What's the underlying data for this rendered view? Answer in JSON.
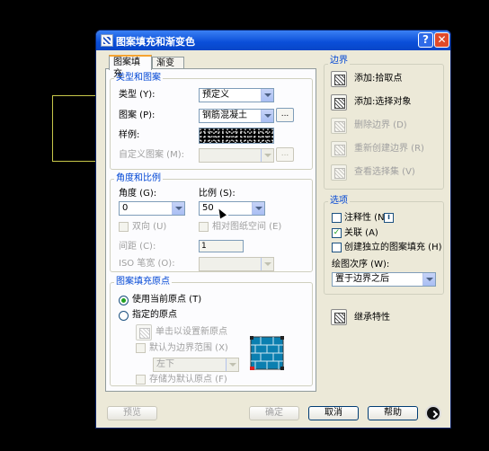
{
  "dialog": {
    "title": "图案填充和渐变色",
    "help_button": "?",
    "close_button": "✕"
  },
  "tabs": [
    {
      "label": "图案填充",
      "active": true
    },
    {
      "label": "渐变色",
      "active": false
    }
  ],
  "type_pattern": {
    "title": "类型和图案",
    "type_label": "类型 (Y):",
    "type_value": "预定义",
    "pattern_label": "图案 (P):",
    "pattern_value": "钢筋混凝土",
    "ellipsis": "...",
    "swatch_label": "样例:",
    "custom_label": "自定义图案 (M):",
    "custom_value": ""
  },
  "angle_scale": {
    "title": "角度和比例",
    "angle_label": "角度 (G):",
    "angle_value": "0",
    "scale_label": "比例 (S):",
    "scale_value": "50",
    "double_label": "双向 (U)",
    "paper_label": "相对图纸空间 (E)",
    "spacing_label": "间距 (C):",
    "spacing_value": "1",
    "iso_label": "ISO 笔宽 (O):",
    "iso_value": ""
  },
  "origin": {
    "title": "图案填充原点",
    "current_label": "使用当前原点 (T)",
    "specified_label": "指定的原点",
    "click_label": "单击以设置新原点",
    "default_bounds_label": "默认为边界范围 (X)",
    "position_value": "左下",
    "store_label": "存储为默认原点 (F)"
  },
  "boundaries": {
    "title": "边界",
    "pick_points": "添加:拾取点",
    "select_objects": "添加:选择对象",
    "remove": "删除边界 (D)",
    "recreate": "重新创建边界 (R)",
    "view": "查看选择集 (V)"
  },
  "options": {
    "title": "选项",
    "annotative_label": "注释性 (N)",
    "annotative_info": "i",
    "associative_label": "关联 (A)",
    "separate_label": "创建独立的图案填充 (H)",
    "draw_order_label": "绘图次序 (W):",
    "draw_order_value": "置于边界之后"
  },
  "inherit": "继承特性",
  "footer": {
    "preview": "预览",
    "ok": "确定",
    "cancel": "取消",
    "help": "帮助"
  },
  "colors": {
    "title_blue": "#0a4ed8",
    "group_title": "#0046d5",
    "dialog_bg": "#ece9d8"
  }
}
